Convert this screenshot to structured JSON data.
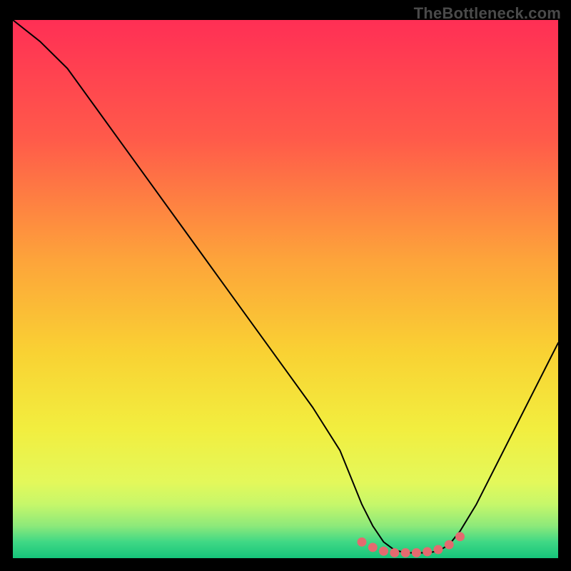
{
  "watermark": "TheBottleneck.com",
  "chart_data": {
    "type": "line",
    "title": "",
    "xlabel": "",
    "ylabel": "",
    "xlim": [
      0,
      100
    ],
    "ylim": [
      0,
      100
    ],
    "series": [
      {
        "name": "curve",
        "x": [
          0,
          5,
          10,
          15,
          20,
          25,
          30,
          35,
          40,
          45,
          50,
          55,
          60,
          62,
          64,
          66,
          68,
          70,
          72,
          74,
          76,
          78,
          80,
          82,
          85,
          90,
          95,
          100
        ],
        "y": [
          100,
          96,
          91,
          84,
          77,
          70,
          63,
          56,
          49,
          42,
          35,
          28,
          20,
          15,
          10,
          6,
          3,
          1.5,
          1,
          1,
          1,
          1.3,
          2.5,
          5,
          10,
          20,
          30,
          40
        ]
      }
    ],
    "flat_region": {
      "x": [
        64,
        66,
        68,
        70,
        72,
        74,
        76,
        78,
        80,
        82
      ],
      "y": [
        3,
        2,
        1.3,
        1,
        1,
        1,
        1.2,
        1.6,
        2.5,
        4
      ]
    },
    "gradient_stops": [
      {
        "offset": 0.0,
        "color": "#ff2f55"
      },
      {
        "offset": 0.22,
        "color": "#ff5a4a"
      },
      {
        "offset": 0.45,
        "color": "#fda53a"
      },
      {
        "offset": 0.62,
        "color": "#f9d233"
      },
      {
        "offset": 0.76,
        "color": "#f2ee3f"
      },
      {
        "offset": 0.86,
        "color": "#e3f85b"
      },
      {
        "offset": 0.9,
        "color": "#c6f76a"
      },
      {
        "offset": 0.94,
        "color": "#8de97a"
      },
      {
        "offset": 0.97,
        "color": "#3fd885"
      },
      {
        "offset": 1.0,
        "color": "#16c47a"
      }
    ],
    "colors": {
      "curve": "#000000",
      "markers": "#e46a6f",
      "background_border": "#000000"
    }
  }
}
